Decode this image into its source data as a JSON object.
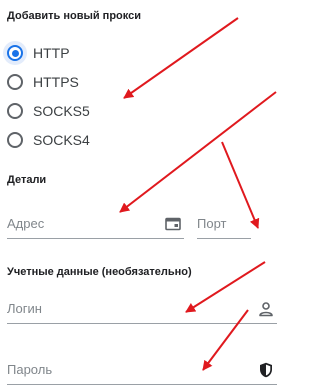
{
  "section_add": {
    "title": "Добавить новый прокси"
  },
  "protocols": [
    {
      "label": "HTTP",
      "selected": true
    },
    {
      "label": "HTTPS",
      "selected": false
    },
    {
      "label": "SOCKS5",
      "selected": false
    },
    {
      "label": "SOCKS4",
      "selected": false
    }
  ],
  "section_details": {
    "title": "Детали",
    "address_placeholder": "Адрес",
    "address_icon": "card-icon",
    "port_placeholder": "Порт"
  },
  "section_credentials": {
    "title": "Учетные данные (необязательно)",
    "login_placeholder": "Логин",
    "login_icon": "person-icon",
    "password_placeholder": "Пароль",
    "password_icon": "shield-icon"
  },
  "colors": {
    "accent": "#1a73e8",
    "annotation": "#e0191e"
  }
}
